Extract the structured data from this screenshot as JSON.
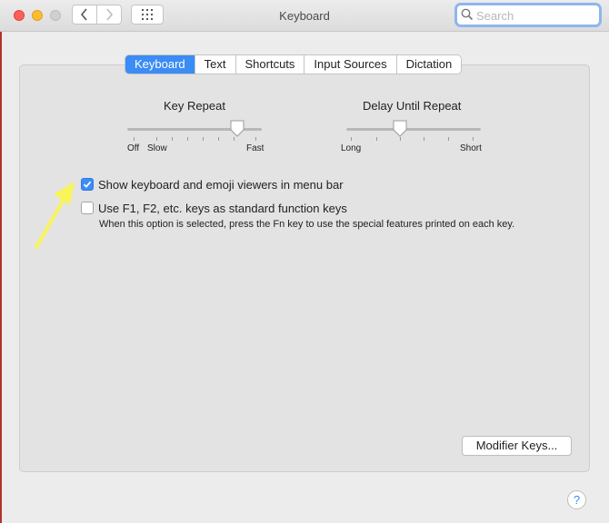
{
  "window": {
    "title": "Keyboard"
  },
  "search": {
    "placeholder": "Search"
  },
  "tabs": [
    {
      "label": "Keyboard",
      "active": true
    },
    {
      "label": "Text"
    },
    {
      "label": "Shortcuts"
    },
    {
      "label": "Input Sources"
    },
    {
      "label": "Dictation"
    }
  ],
  "key_repeat": {
    "title": "Key Repeat",
    "labels": {
      "off": "Off",
      "slow": "Slow",
      "fast": "Fast"
    },
    "value": 0.88
  },
  "delay_until_repeat": {
    "title": "Delay Until Repeat",
    "labels": {
      "long": "Long",
      "short": "Short"
    },
    "value": 0.4
  },
  "options": {
    "show_viewers": {
      "label": "Show keyboard and emoji viewers in menu bar",
      "checked": true
    },
    "function_keys": {
      "label": "Use F1, F2, etc. keys as standard function keys",
      "checked": false,
      "note": "When this option is selected, press the Fn key to use the special features printed on each key."
    }
  },
  "buttons": {
    "modifier_keys": "Modifier Keys...",
    "help": "?"
  },
  "annotation": {
    "arrow_color": "#f7f55a"
  },
  "colors": {
    "accent": "#3b8cf5"
  }
}
